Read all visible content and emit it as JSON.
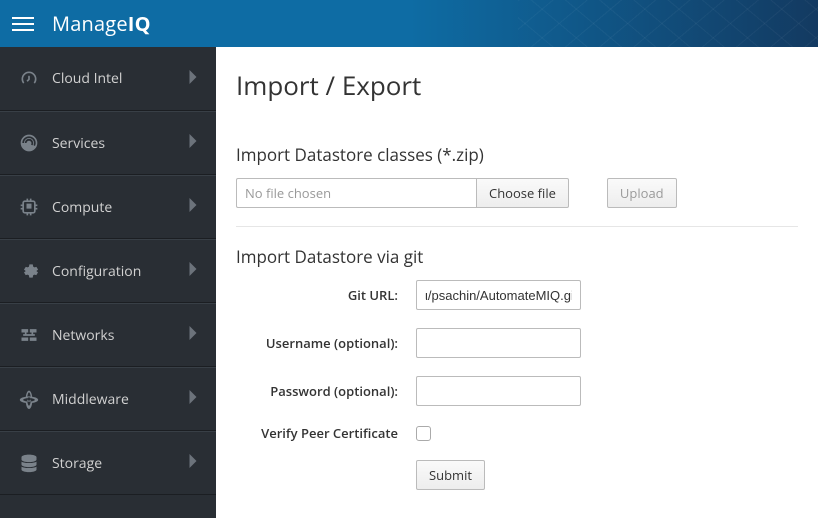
{
  "header": {
    "brand_prefix": "Manage",
    "brand_suffix": "IQ"
  },
  "sidebar": {
    "items": [
      {
        "label": "Cloud Intel",
        "icon": "dashboard-icon"
      },
      {
        "label": "Services",
        "icon": "orbit-icon"
      },
      {
        "label": "Compute",
        "icon": "cpu-icon"
      },
      {
        "label": "Configuration",
        "icon": "gear-icon"
      },
      {
        "label": "Networks",
        "icon": "network-icon"
      },
      {
        "label": "Middleware",
        "icon": "atom-icon"
      },
      {
        "label": "Storage",
        "icon": "database-icon"
      }
    ]
  },
  "main": {
    "title": "Import / Export",
    "zip_section": {
      "title": "Import Datastore classes (*.zip)",
      "file_placeholder": "No file chosen",
      "choose_label": "Choose file",
      "upload_label": "Upload"
    },
    "git_section": {
      "title": "Import Datastore via git",
      "git_url_label": "Git URL:",
      "git_url_value": "ι/psachin/AutomateMIQ.git",
      "username_label": "Username (optional):",
      "username_value": "",
      "password_label": "Password (optional):",
      "password_value": "",
      "verify_label": "Verify Peer Certificate",
      "verify_checked": false,
      "submit_label": "Submit"
    }
  }
}
